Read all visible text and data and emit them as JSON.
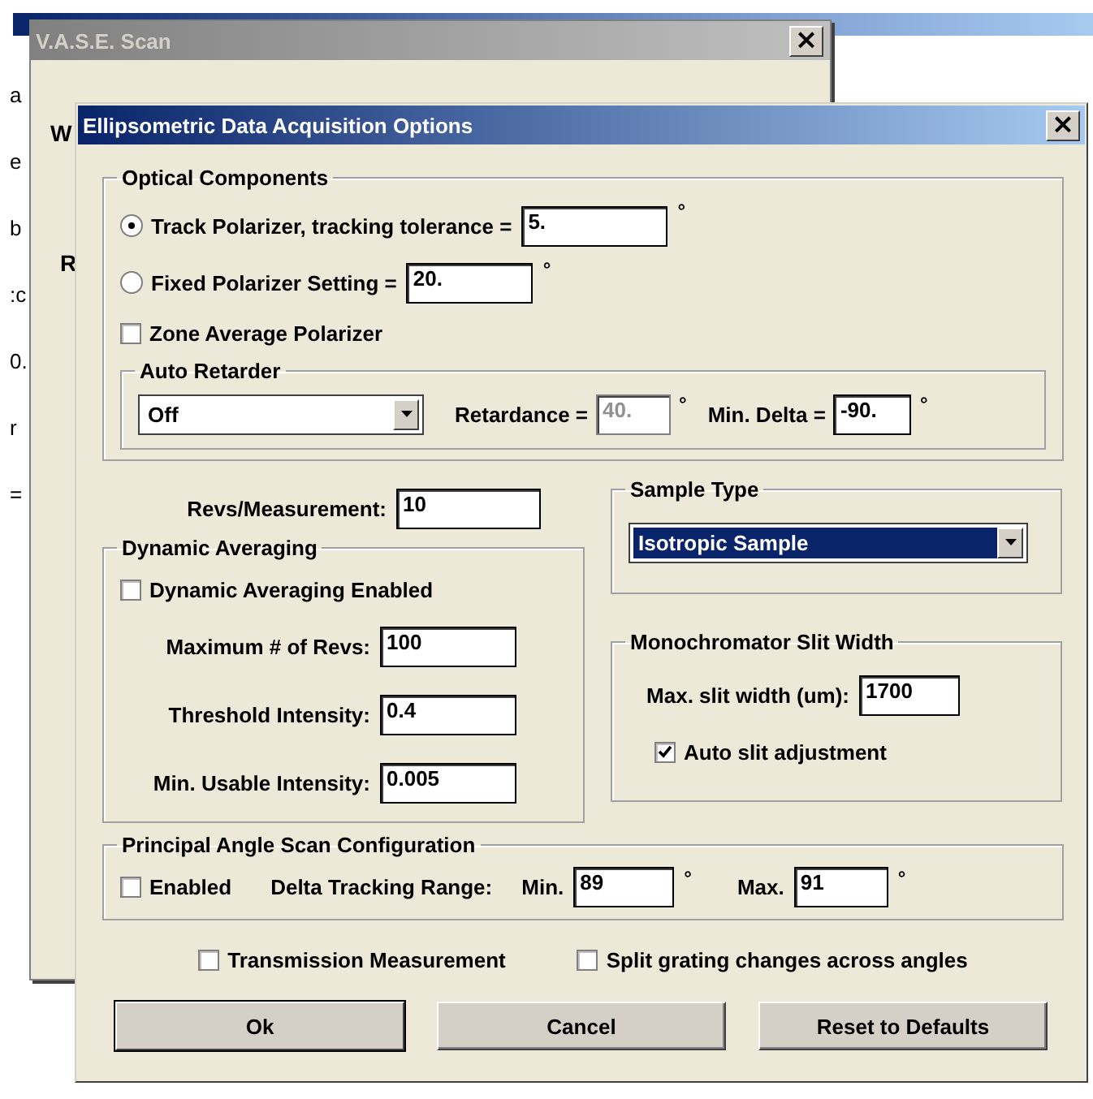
{
  "edge_fragments": [
    "a",
    "e",
    "b",
    ":c",
    "0.",
    "r",
    "="
  ],
  "background_window": {
    "title": "V.A.S.E. Scan",
    "close": "×",
    "fragments": [
      "W",
      "R"
    ]
  },
  "dialog": {
    "title": "Ellipsometric Data Acquisition Options",
    "close": "×",
    "optical_components": {
      "title": "Optical Components",
      "rows": [
        {
          "kind": "radio",
          "label": "Track Polarizer, tracking tolerance =",
          "selected": true,
          "value": "5.",
          "unit": "°"
        },
        {
          "kind": "radio",
          "label": "Fixed Polarizer Setting =",
          "selected": false,
          "value": "20.",
          "unit": "°"
        },
        {
          "kind": "checkbox",
          "label": "Zone Average Polarizer",
          "checked": false
        }
      ],
      "auto_retarder": {
        "title": "Auto Retarder",
        "dropdown": {
          "value": "Off",
          "highlighted": false
        },
        "fields": [
          {
            "label": "Retardance =",
            "value": "40.",
            "unit": "°",
            "disabled": true
          },
          {
            "label": "Min. Delta =",
            "value": "-90.",
            "unit": "°",
            "disabled": false
          }
        ]
      }
    },
    "revs": {
      "label": "Revs/Measurement:",
      "value": "10"
    },
    "dynamic_averaging": {
      "title": "Dynamic Averaging",
      "enabled": {
        "label": "Dynamic Averaging Enabled",
        "checked": false
      },
      "fields": [
        {
          "label": "Maximum # of Revs:",
          "value": "100"
        },
        {
          "label": "Threshold Intensity:",
          "value": "0.4"
        },
        {
          "label": "Min. Usable Intensity:",
          "value": "0.005"
        }
      ]
    },
    "sample_type": {
      "title": "Sample Type",
      "dropdown": {
        "value": "Isotropic Sample",
        "highlighted": true
      }
    },
    "monochromator": {
      "title": "Monochromator Slit Width",
      "field": {
        "label": "Max. slit width (um):",
        "value": "1700"
      },
      "auto": {
        "label": "Auto slit adjustment",
        "checked": true
      }
    },
    "principal_angle": {
      "title": "Principal Angle Scan Configuration",
      "enabled": {
        "label": "Enabled",
        "checked": false
      },
      "range_label": "Delta Tracking Range:",
      "fields": [
        {
          "label": "Min.",
          "value": "89",
          "unit": "°"
        },
        {
          "label": "Max.",
          "value": "91",
          "unit": "°"
        }
      ]
    },
    "options": [
      {
        "label": "Transmission Measurement",
        "checked": false
      },
      {
        "label": "Split grating changes across angles",
        "checked": false
      }
    ],
    "buttons": [
      {
        "label": "Ok",
        "default": true
      },
      {
        "label": "Cancel",
        "default": false
      },
      {
        "label": "Reset to Defaults",
        "default": false
      }
    ]
  }
}
